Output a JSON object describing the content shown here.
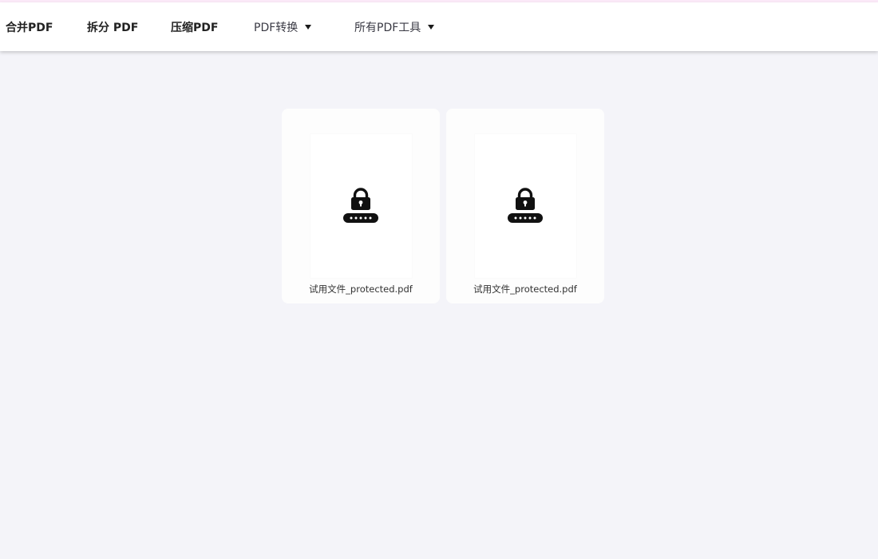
{
  "nav": {
    "merge": "合并PDF",
    "split": "拆分 PDF",
    "compress": "压缩PDF",
    "convert": "PDF转换",
    "all_tools": "所有PDF工具"
  },
  "files": [
    {
      "name": "试用文件_protected.pdf",
      "icon": "lock-password-icon"
    },
    {
      "name": "试用文件_protected.pdf",
      "icon": "lock-password-icon"
    }
  ],
  "colors": {
    "background": "#f4f4f9",
    "navbar": "#ffffff",
    "top_accent": "#fbe9f8",
    "icon": "#111111"
  }
}
